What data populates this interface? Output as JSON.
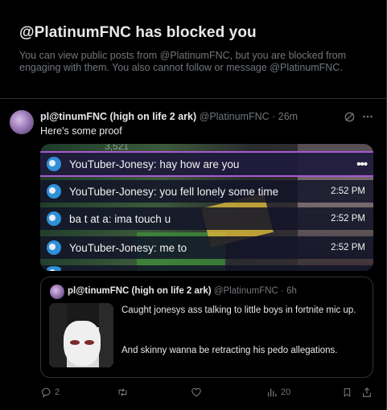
{
  "blocked": {
    "title": "@PlatinumFNC has blocked you",
    "description": "You can view public posts from @PlatinumFNC, but you are blocked from engaging with them. You also cannot follow or message @PlatinumFNC."
  },
  "tweet": {
    "display_name": "pl@tinumFNC (high on life 2 ark)",
    "handle_time": "@PlatinumFNC · 26m",
    "text": "Here's some proof",
    "media": {
      "top_partial": "3,521",
      "messages": [
        {
          "text": "YouTuber-Jonesy: hay how are you",
          "time": ""
        },
        {
          "text": "YouTuber-Jonesy: you fell lonely some time",
          "time": "2:52 PM"
        },
        {
          "text": "ba t at a: ima touch u",
          "time": "2:52 PM"
        },
        {
          "text": "YouTuber-Jonesy: me to",
          "time": "2:52 PM"
        }
      ],
      "more_label": "•••"
    },
    "quote": {
      "display_name": "pl@tinumFNC (high on life 2 ark)",
      "handle_time": "@PlatinumFNC · 6h",
      "text1": "Caught jonesys ass talking to little boys in fortnite mic up.",
      "text2": "And skinny wanna be retracting his pedo allegations."
    },
    "actions": {
      "replies": "2",
      "retweets": "",
      "likes": "",
      "views": "20"
    }
  },
  "icons": {
    "grok": "grok-icon",
    "more": "more-icon",
    "reply": "reply-icon",
    "retweet": "retweet-icon",
    "like": "like-icon",
    "views": "views-icon",
    "bookmark": "bookmark-icon",
    "share": "share-icon"
  }
}
